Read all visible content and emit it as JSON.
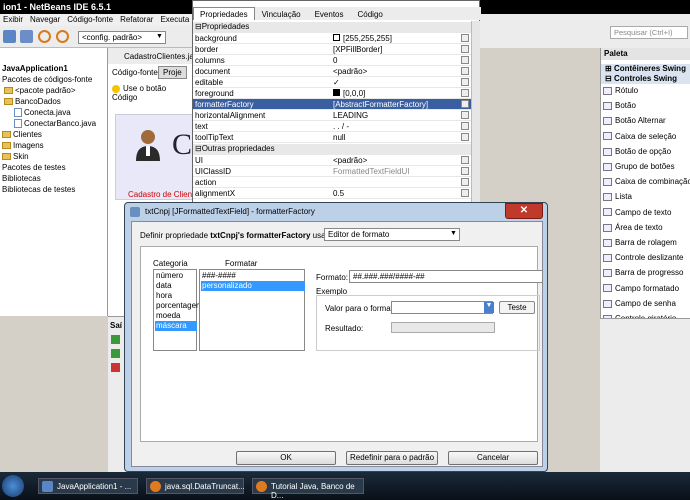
{
  "ide": {
    "title": "ion1 - NetBeans IDE 6.5.1",
    "menu": [
      "Exibir",
      "Navegar",
      "Código-fonte",
      "Refatorar",
      "Executa"
    ],
    "config_combo": "<config. padrão>",
    "search_placeholder": "Pesquisar (Ctrl+I)"
  },
  "project_tree": [
    "JavaApplication1",
    "Pacotes de códigos-fonte",
    "<pacote padrão>",
    "BancoDados",
    "Conecta.java",
    "ConectarBanco.java",
    "Clientes",
    "Imagens",
    "Skin",
    "Pacotes de testes",
    "Bibliotecas",
    "Bibliotecas de testes"
  ],
  "editor": {
    "file_tab": "CadastroClientes.java",
    "tab_source": "Código-fonte",
    "tab_design": "Proje",
    "hint": "Use o botão Código",
    "form_title_char": "C",
    "form_red_label": "Cadastro de Cliente",
    "output_tab": "Saí"
  },
  "properties": {
    "tabs": [
      "Propriedades",
      "Vinculação",
      "Eventos",
      "Código"
    ],
    "section1": "Propriedades",
    "rows": [
      {
        "name": "background",
        "value": "[255,255,255]"
      },
      {
        "name": "border",
        "value": "[XPFillBorder]"
      },
      {
        "name": "columns",
        "value": "0"
      },
      {
        "name": "document",
        "value": "<padrão>"
      },
      {
        "name": "editable",
        "value": "✓"
      },
      {
        "name": "foreground",
        "value": "[0,0,0]"
      },
      {
        "name": "formatterFactory",
        "value": "[AbstractFormatterFactory]"
      },
      {
        "name": "horizontalAlignment",
        "value": "LEADING"
      },
      {
        "name": "text",
        "value": ". . / -"
      },
      {
        "name": "toolTipText",
        "value": "null"
      }
    ],
    "section2": "Outras propriedades",
    "rows2": [
      {
        "name": "UI",
        "value": "<padrão>"
      },
      {
        "name": "UIClassID",
        "value": "FormattedTextFieldUI"
      },
      {
        "name": "action",
        "value": ""
      },
      {
        "name": "alignmentX",
        "value": "0.5"
      }
    ]
  },
  "palette": {
    "title": "Paleta",
    "section_containers": "Contêineres Swing",
    "section_controls": "Controles Swing",
    "items": [
      "Rótulo",
      "Botão",
      "Botão Alternar",
      "Caixa de seleção",
      "Botão de opção",
      "Grupo de botões",
      "Caixa de combinação",
      "Lista",
      "Campo de texto",
      "Área de texto",
      "Barra de rolagem",
      "Controle deslizante",
      "Barra de progresso",
      "Campo formatado",
      "Campo de senha",
      "Controle giratório"
    ]
  },
  "dialog": {
    "title": "txtCnpj [JFormattedTextField] - formatterFactory",
    "define_prefix": "Definir propriedade ",
    "define_bold": "txtCnpj's formatterFactory",
    "define_suffix": " usando:",
    "editor_combo": "Editor de formato",
    "category_label": "Categoria",
    "format_label": "Formatar",
    "categories": [
      "número",
      "data",
      "hora",
      "porcentagem",
      "moeda",
      "máscara"
    ],
    "selected_category": "máscara",
    "formats": [
      "###-####",
      "personalizado"
    ],
    "selected_format": "personalizado",
    "format_field_label": "Formato:",
    "format_field_value": "##.###.###/####-##",
    "example_label": "Exemplo",
    "value_label": "Valor para o formato:",
    "test_button": "Teste",
    "result_label": "Resultado:",
    "ok_button": "OK",
    "reset_button": "Redefinir para o padrão",
    "cancel_button": "Cancelar"
  },
  "taskbar": {
    "items": [
      "JavaApplication1 - ...",
      "java.sql.DataTruncat...",
      "Tutorial Java, Banco de D..."
    ]
  }
}
